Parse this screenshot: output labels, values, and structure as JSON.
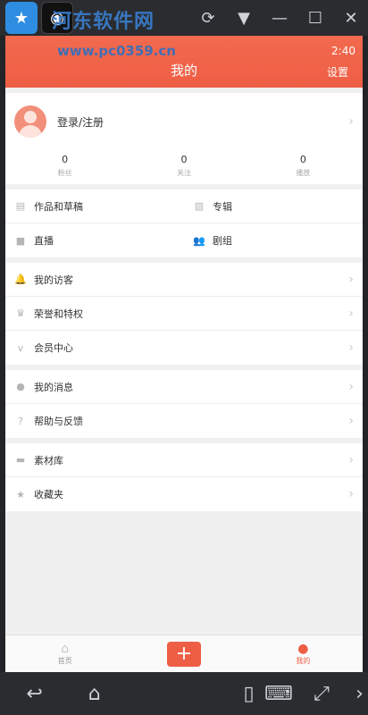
{
  "window": {
    "watermark_title": "河东软件网",
    "watermark_url": "www.pc0359.cn"
  },
  "status": {
    "time": "2:40"
  },
  "header": {
    "title": "我的",
    "settings": "设置"
  },
  "profile": {
    "login_label": "登录/注册"
  },
  "stats": [
    {
      "value": "0",
      "label": "粉丝"
    },
    {
      "value": "0",
      "label": "关注"
    },
    {
      "value": "0",
      "label": "播放"
    }
  ],
  "works_grid": [
    {
      "label": "作品和草稿",
      "icon": "clapper-icon"
    },
    {
      "label": "专辑",
      "icon": "image-icon"
    },
    {
      "label": "直播",
      "icon": "video-camera-icon"
    },
    {
      "label": "剧组",
      "icon": "group-icon"
    }
  ],
  "menu_group1": [
    {
      "label": "我的访客",
      "icon": "bell-icon"
    },
    {
      "label": "荣誉和特权",
      "icon": "trophy-icon"
    },
    {
      "label": "会员中心",
      "icon": "vip-icon"
    }
  ],
  "menu_group2": [
    {
      "label": "我的消息",
      "icon": "chat-icon"
    },
    {
      "label": "帮助与反馈",
      "icon": "help-icon"
    }
  ],
  "menu_group3": [
    {
      "label": "素材库",
      "icon": "folder-icon"
    },
    {
      "label": "收藏夹",
      "icon": "star-icon"
    }
  ],
  "tabbar": {
    "home": "首页",
    "add": "+",
    "mine": "我的"
  },
  "colors": {
    "accent": "#ee5e45"
  }
}
